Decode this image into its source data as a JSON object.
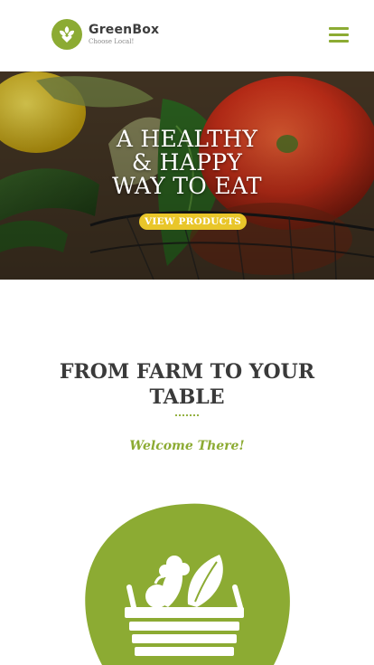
{
  "brand": {
    "name": "GreenBox",
    "tagline": "Choose Local!"
  },
  "colors": {
    "accent": "#8cab33",
    "button": "#e9c62a",
    "heading": "#3a3a3a"
  },
  "header": {
    "menu_icon": "hamburger-icon"
  },
  "hero": {
    "title_lines": [
      "A HEALTHY",
      "& HAPPY",
      "WAY TO EAT"
    ],
    "button_label": "VIEW PRODUCTS"
  },
  "intro": {
    "title_lines": [
      "FROM FARM TO YOUR",
      "TABLE"
    ],
    "subtitle": "Welcome There!",
    "illustration_icon": "vegetable-basket-icon"
  }
}
